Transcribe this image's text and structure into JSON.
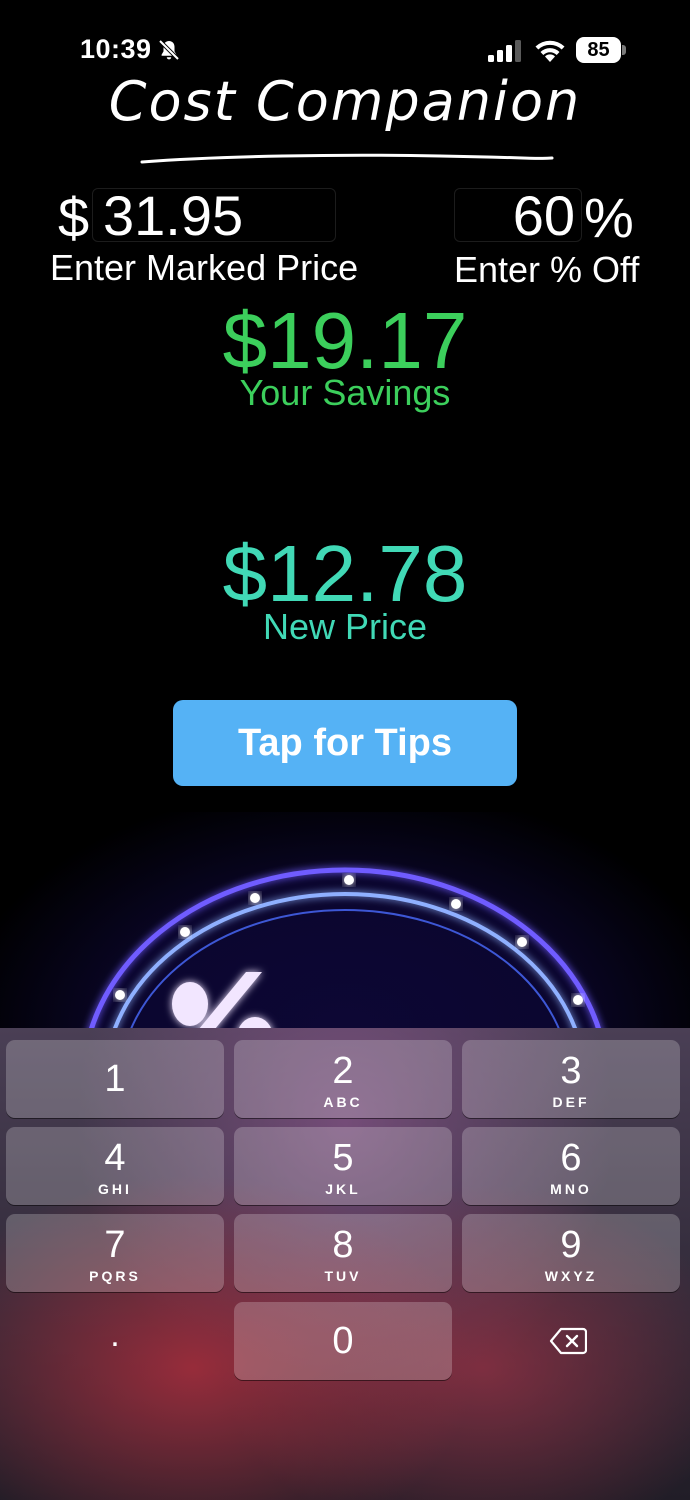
{
  "status_bar": {
    "time": "10:39",
    "battery": "85",
    "icons": [
      "bell-slash-icon",
      "cellular-signal-icon",
      "wifi-icon",
      "battery-icon"
    ]
  },
  "app": {
    "title": "Cost Companion"
  },
  "inputs": {
    "currency_symbol": "$",
    "marked_price": "31.95",
    "marked_price_label": "Enter Marked Price",
    "percent_off": "60",
    "percent_symbol": "%",
    "percent_off_label": "Enter % Off"
  },
  "results": {
    "savings_value": "$19.17",
    "savings_label": "Your Savings",
    "new_price_value": "$12.78",
    "new_price_label": "New Price"
  },
  "tips_button": {
    "label": "Tap for Tips"
  },
  "keypad": {
    "keys": [
      {
        "num": "1",
        "letters": ""
      },
      {
        "num": "2",
        "letters": "ABC"
      },
      {
        "num": "3",
        "letters": "DEF"
      },
      {
        "num": "4",
        "letters": "GHI"
      },
      {
        "num": "5",
        "letters": "JKL"
      },
      {
        "num": "6",
        "letters": "MNO"
      },
      {
        "num": "7",
        "letters": "PQRS"
      },
      {
        "num": "8",
        "letters": "TUV"
      },
      {
        "num": "9",
        "letters": "WXYZ"
      },
      {
        "num": ".",
        "letters": ""
      },
      {
        "num": "0",
        "letters": ""
      }
    ],
    "delete_icon": "backspace-icon"
  },
  "colors": {
    "savings": "#3ccf5c",
    "new_price": "#41d9b6",
    "button": "#55b2f5",
    "background": "#000000"
  }
}
